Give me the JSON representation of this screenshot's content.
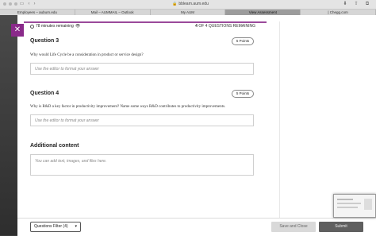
{
  "browser": {
    "address": "bblearn.aum.edu",
    "tabs": [
      {
        "label": "Employees – auburn.edu",
        "active": false
      },
      {
        "label": "Mail – AUMMAIL – Outlook",
        "active": false
      },
      {
        "label": "My AUM",
        "active": false
      },
      {
        "label": "View Assessment",
        "active": true
      },
      {
        "label": "| Chegg.com",
        "active": false
      }
    ]
  },
  "assessment": {
    "timer": "78 minutes remaining",
    "remaining_count": "4",
    "remaining_text": "OF 4 QUESTIONS REMAINING"
  },
  "questions": [
    {
      "title": "Question 3",
      "points": "5 Points",
      "text": "Why would Life Cycle be a consideration in product or service design?",
      "placeholder": "Use the editor to format your answer"
    },
    {
      "title": "Question 4",
      "points": "5 Points",
      "text": "Why is R&D a key factor in productivity improvement? Name some ways R&D contributes to productivity improvements.",
      "placeholder": "Use the editor to format your answer"
    }
  ],
  "additional": {
    "title": "Additional content",
    "placeholder": "You can add text, images, and files here."
  },
  "footer": {
    "filter_label": "Questions Filter (4)",
    "save_close": "Save and Close",
    "submit": "Submit"
  },
  "colors": {
    "accent": "#9b4a9b",
    "submit_bg": "#5f5f5f"
  }
}
